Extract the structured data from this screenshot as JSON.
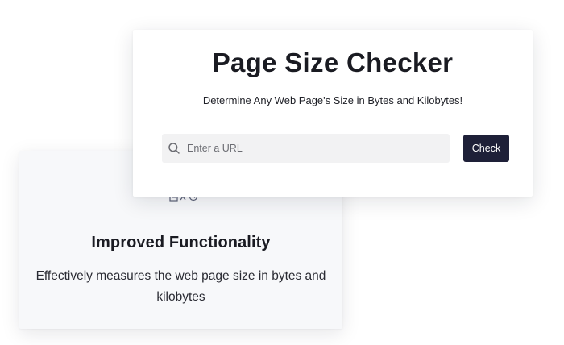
{
  "feature": {
    "icon": "tools-icon",
    "title": "Improved Functionality",
    "description": "Effectively measures the web page size in bytes and kilobytes"
  },
  "checker": {
    "title": "Page Size Checker",
    "subtitle": "Determine Any Web Page's Size in Bytes and Kilobytes!",
    "search": {
      "placeholder": "Enter a URL",
      "value": "",
      "icon": "search-icon"
    },
    "button_label": "Check"
  },
  "colors": {
    "button_bg": "#1e2038",
    "input_bg": "#f2f2f3",
    "feature_card_bg": "#f7f8fa",
    "text": "#1a1b22"
  }
}
